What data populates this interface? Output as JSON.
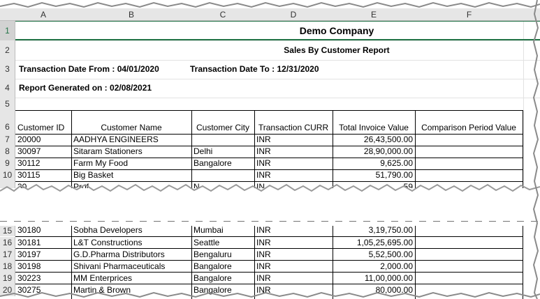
{
  "columns": [
    "A",
    "B",
    "C",
    "D",
    "E",
    "F"
  ],
  "company_title": "Demo Company",
  "report_title": "Sales By Customer Report",
  "date_from": "Transaction Date From : 04/01/2020",
  "date_to": "Transaction Date To : 12/31/2020",
  "generated_on": "Report Generated on : 02/08/2021",
  "headers": [
    "Customer ID",
    "Customer Name",
    "Customer City",
    "Transaction CURR",
    "Total Invoice Value",
    "Comparison Period Value"
  ],
  "top_row_numbers": [
    "1",
    "2",
    "3",
    "4",
    "5",
    "6",
    "7",
    "8",
    "9",
    "10"
  ],
  "top_rows": [
    {
      "id": "20000",
      "name": "AADHYA ENGINEERS",
      "city": "",
      "curr": "INR",
      "value": "26,43,500.00"
    },
    {
      "id": "30097",
      "name": "Sitaram Stationers",
      "city": "Delhi",
      "curr": "INR",
      "value": "28,90,000.00"
    },
    {
      "id": "30112",
      "name": "Farm My Food",
      "city": "Bangalore",
      "curr": "INR",
      "value": "9,625.00"
    },
    {
      "id": "30115",
      "name": "Big Basket",
      "city": "",
      "curr": "INR",
      "value": "51,790.00"
    }
  ],
  "partial_rows": {
    "top_id": "30",
    "top_name": "Prof",
    "top_city": "N",
    "top_curr": "IN",
    "top_value": "59",
    "bottom_rownum": "15",
    "bottom_id": "30180",
    "bottom_name": "Sobha Developers",
    "bottom_city": "Mumbai",
    "bottom_curr": "INR",
    "bottom_value": "3,19,750.00"
  },
  "bottom_rows": [
    {
      "row": "16",
      "id": "30181",
      "name": "L&T Constructions",
      "city": "Seattle",
      "curr": "INR",
      "value": "1,05,25,695.00"
    },
    {
      "row": "17",
      "id": "30197",
      "name": "G.D.Pharma Distributors",
      "city": "Bengaluru",
      "curr": "INR",
      "value": "5,52,500.00"
    },
    {
      "row": "18",
      "id": "30198",
      "name": "Shivani Pharmaceuticals",
      "city": "Bangalore",
      "curr": "INR",
      "value": "2,000.00"
    },
    {
      "row": "19",
      "id": "30223",
      "name": "MM Enterprices",
      "city": "Bangalore",
      "curr": "INR",
      "value": "11,00,000.00"
    },
    {
      "row": "20",
      "id": "30275",
      "name": "Martin & Brown",
      "city": "Bangalore",
      "curr": "INR",
      "value": "80,000.00"
    }
  ],
  "colors": {
    "accent": "#217346",
    "header_bg": "#e6e6e6",
    "grid": "#e2e2e2"
  }
}
